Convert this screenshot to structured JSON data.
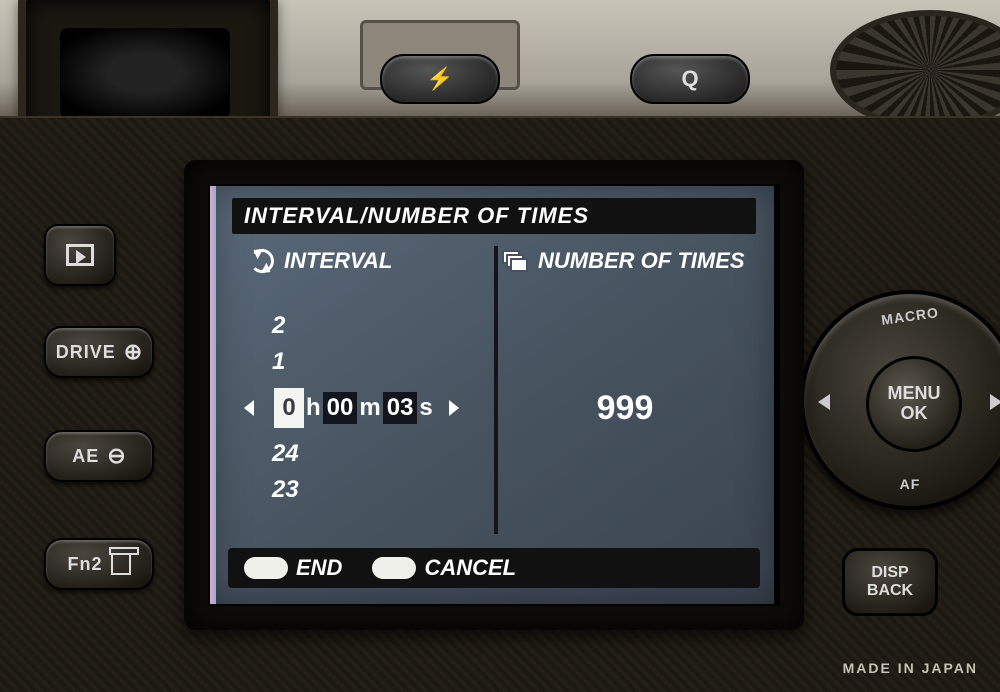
{
  "screen": {
    "title": "INTERVAL/NUMBER OF TIMES",
    "interval": {
      "header": "INTERVAL",
      "spinner_above_2": "2",
      "spinner_above_1": "1",
      "hours_value": "0",
      "hours_unit": "h",
      "minutes_value": "00",
      "minutes_unit": "m",
      "seconds_value": "03",
      "seconds_unit": "s",
      "spinner_below_1": "24",
      "spinner_below_2": "23"
    },
    "times": {
      "header": "NUMBER OF TIMES",
      "value": "999"
    },
    "footer": {
      "end": "END",
      "cancel": "CANCEL"
    }
  },
  "body": {
    "top_flash": "⚡",
    "top_q": "Q",
    "left": {
      "drive": "DRIVE",
      "ae": "AE",
      "fn2": "Fn2",
      "zoom_in": "⊕",
      "zoom_out": "⊖"
    },
    "dpad": {
      "macro": "MACRO",
      "af": "AF",
      "menu": "MENU",
      "ok": "OK"
    },
    "dispback": {
      "disp": "DISP",
      "back": "BACK"
    },
    "made_in": "MADE IN JAPAN"
  }
}
